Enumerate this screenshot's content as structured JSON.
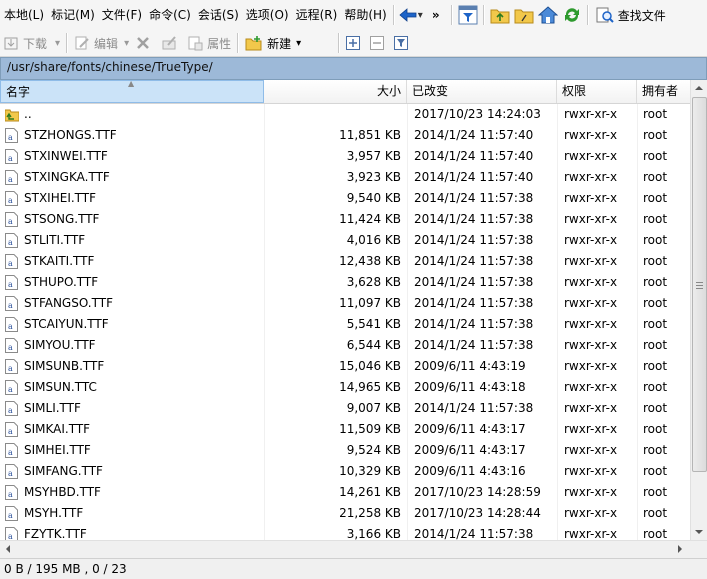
{
  "menubar": {
    "items": [
      "本地(L)",
      "标记(M)",
      "文件(F)",
      "命令(C)",
      "会话(S)",
      "选项(O)",
      "远程(R)",
      "帮助(H)"
    ],
    "more": "»",
    "find_files_label": "查找文件"
  },
  "toolbar2": {
    "download_label": "下载",
    "edit_label": "编辑",
    "properties_label": "属性",
    "new_label": "新建"
  },
  "path": "/usr/share/fonts/chinese/TrueType/",
  "columns": {
    "name": "名字",
    "size": "大小",
    "modified": "已改变",
    "permissions": "权限",
    "owner": "拥有者"
  },
  "files": [
    {
      "name": "..",
      "size": "",
      "modified": "2017/10/23 14:24:03",
      "perm": "rwxr-xr-x",
      "owner": "root",
      "type": "parent"
    },
    {
      "name": "STZHONGS.TTF",
      "size": "11,851 KB",
      "modified": "2014/1/24 11:57:40",
      "perm": "rwxr-xr-x",
      "owner": "root",
      "type": "font"
    },
    {
      "name": "STXINWEI.TTF",
      "size": "3,957 KB",
      "modified": "2014/1/24 11:57:40",
      "perm": "rwxr-xr-x",
      "owner": "root",
      "type": "font"
    },
    {
      "name": "STXINGKA.TTF",
      "size": "3,923 KB",
      "modified": "2014/1/24 11:57:40",
      "perm": "rwxr-xr-x",
      "owner": "root",
      "type": "font"
    },
    {
      "name": "STXIHEI.TTF",
      "size": "9,540 KB",
      "modified": "2014/1/24 11:57:38",
      "perm": "rwxr-xr-x",
      "owner": "root",
      "type": "font"
    },
    {
      "name": "STSONG.TTF",
      "size": "11,424 KB",
      "modified": "2014/1/24 11:57:38",
      "perm": "rwxr-xr-x",
      "owner": "root",
      "type": "font"
    },
    {
      "name": "STLITI.TTF",
      "size": "4,016 KB",
      "modified": "2014/1/24 11:57:38",
      "perm": "rwxr-xr-x",
      "owner": "root",
      "type": "font"
    },
    {
      "name": "STKAITI.TTF",
      "size": "12,438 KB",
      "modified": "2014/1/24 11:57:38",
      "perm": "rwxr-xr-x",
      "owner": "root",
      "type": "font"
    },
    {
      "name": "STHUPO.TTF",
      "size": "3,628 KB",
      "modified": "2014/1/24 11:57:38",
      "perm": "rwxr-xr-x",
      "owner": "root",
      "type": "font"
    },
    {
      "name": "STFANGSO.TTF",
      "size": "11,097 KB",
      "modified": "2014/1/24 11:57:38",
      "perm": "rwxr-xr-x",
      "owner": "root",
      "type": "font"
    },
    {
      "name": "STCAIYUN.TTF",
      "size": "5,541 KB",
      "modified": "2014/1/24 11:57:38",
      "perm": "rwxr-xr-x",
      "owner": "root",
      "type": "font"
    },
    {
      "name": "SIMYOU.TTF",
      "size": "6,544 KB",
      "modified": "2014/1/24 11:57:38",
      "perm": "rwxr-xr-x",
      "owner": "root",
      "type": "font"
    },
    {
      "name": "SIMSUNB.TTF",
      "size": "15,046 KB",
      "modified": "2009/6/11 4:43:19",
      "perm": "rwxr-xr-x",
      "owner": "root",
      "type": "font"
    },
    {
      "name": "SIMSUN.TTC",
      "size": "14,965 KB",
      "modified": "2009/6/11 4:43:18",
      "perm": "rwxr-xr-x",
      "owner": "root",
      "type": "font"
    },
    {
      "name": "SIMLI.TTF",
      "size": "9,007 KB",
      "modified": "2014/1/24 11:57:38",
      "perm": "rwxr-xr-x",
      "owner": "root",
      "type": "font"
    },
    {
      "name": "SIMKAI.TTF",
      "size": "11,509 KB",
      "modified": "2009/6/11 4:43:17",
      "perm": "rwxr-xr-x",
      "owner": "root",
      "type": "font"
    },
    {
      "name": "SIMHEI.TTF",
      "size": "9,524 KB",
      "modified": "2009/6/11 4:43:17",
      "perm": "rwxr-xr-x",
      "owner": "root",
      "type": "font"
    },
    {
      "name": "SIMFANG.TTF",
      "size": "10,329 KB",
      "modified": "2009/6/11 4:43:16",
      "perm": "rwxr-xr-x",
      "owner": "root",
      "type": "font"
    },
    {
      "name": "MSYHBD.TTF",
      "size": "14,261 KB",
      "modified": "2017/10/23 14:28:59",
      "perm": "rwxr-xr-x",
      "owner": "root",
      "type": "font"
    },
    {
      "name": "MSYH.TTF",
      "size": "21,258 KB",
      "modified": "2017/10/23 14:28:44",
      "perm": "rwxr-xr-x",
      "owner": "root",
      "type": "font"
    },
    {
      "name": "FZYTK.TTF",
      "size": "3,166 KB",
      "modified": "2014/1/24 11:57:38",
      "perm": "rwxr-xr-x",
      "owner": "root",
      "type": "font"
    }
  ],
  "status": "0 B / 195 MB ,  0 / 23",
  "colors": {
    "path_bar": "#9db9d8",
    "name_header_selected": "#cbe3f8",
    "accent_green": "#2e9a2e",
    "accent_blue": "#1e64c8"
  }
}
